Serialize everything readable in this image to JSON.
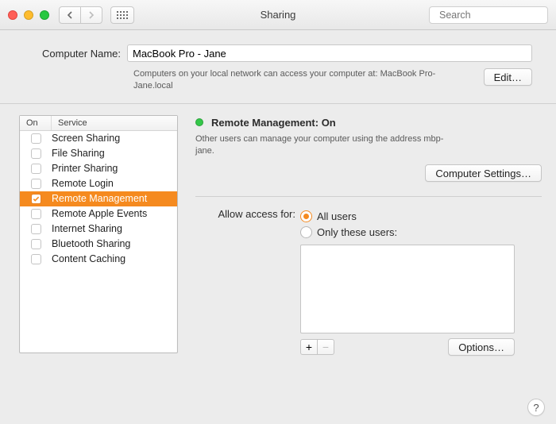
{
  "window": {
    "title": "Sharing",
    "search_placeholder": "Search"
  },
  "computer_name": {
    "label": "Computer Name:",
    "value": "MacBook Pro - Jane",
    "note": "Computers on your local network can access your computer at: MacBook Pro-Jane.local",
    "edit_label": "Edit…"
  },
  "services": {
    "col_on": "On",
    "col_service": "Service",
    "items": [
      {
        "label": "Screen Sharing",
        "on": false,
        "selected": false
      },
      {
        "label": "File Sharing",
        "on": false,
        "selected": false
      },
      {
        "label": "Printer Sharing",
        "on": false,
        "selected": false
      },
      {
        "label": "Remote Login",
        "on": false,
        "selected": false
      },
      {
        "label": "Remote Management",
        "on": true,
        "selected": true
      },
      {
        "label": "Remote Apple Events",
        "on": false,
        "selected": false
      },
      {
        "label": "Internet Sharing",
        "on": false,
        "selected": false
      },
      {
        "label": "Bluetooth Sharing",
        "on": false,
        "selected": false
      },
      {
        "label": "Content Caching",
        "on": false,
        "selected": false
      }
    ]
  },
  "detail": {
    "status_title": "Remote Management: On",
    "status_color": "#34c749",
    "description": "Other users can manage your computer using the address mbp-jane.",
    "computer_settings_label": "Computer Settings…",
    "access_label": "Allow access for:",
    "radio_all": "All users",
    "radio_only": "Only these users:",
    "selected_radio": "all",
    "options_label": "Options…"
  },
  "buttons": {
    "add": "+",
    "remove": "−",
    "help": "?"
  }
}
